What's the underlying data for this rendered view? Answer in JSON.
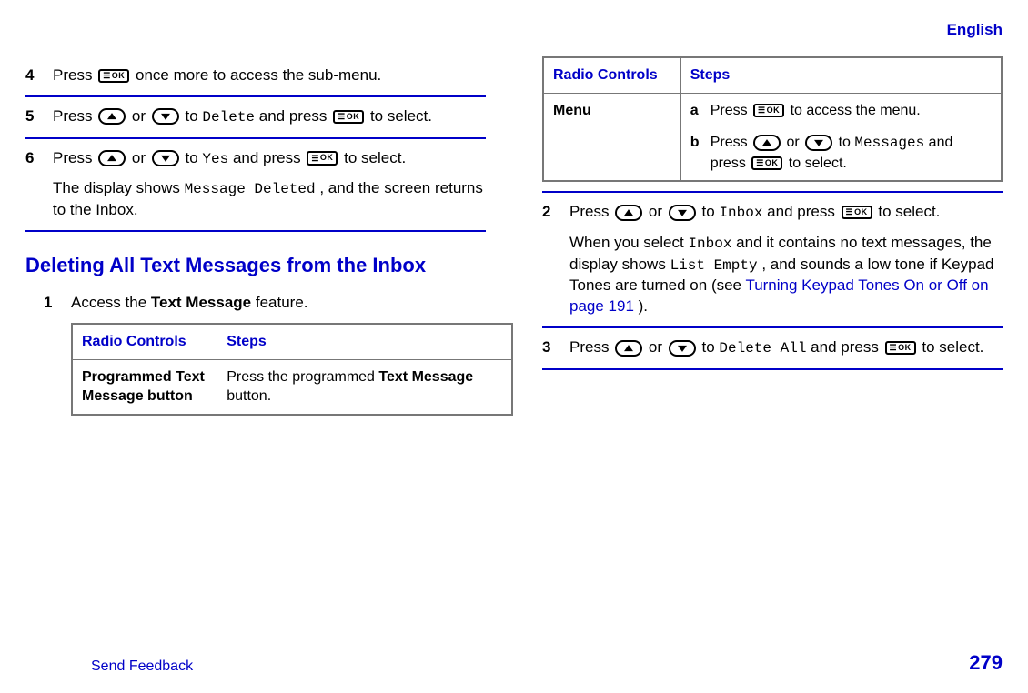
{
  "header": {
    "language": "English"
  },
  "left": {
    "steps": [
      {
        "num": "4",
        "parts": [
          {
            "pre": "Press ",
            "icon": "ok",
            "post": " once more to access the sub-menu."
          }
        ]
      },
      {
        "num": "5",
        "parts": [
          {
            "pre": "Press ",
            "icon": "up",
            "mid": " or ",
            "icon2": "down",
            "post_to": " to ",
            "mono": "Delete",
            "and_press": " and press ",
            "icon3": "ok",
            "tail": " to select."
          }
        ]
      },
      {
        "num": "6",
        "parts": [
          {
            "pre": "Press ",
            "icon": "up",
            "mid": " or ",
            "icon2": "down",
            "post_to": " to ",
            "mono": "Yes",
            "and_press": " and press ",
            "icon3": "ok",
            "tail": " to select."
          }
        ],
        "para2": {
          "t1": "The display shows ",
          "mono": "Message Deleted",
          "t2": ", and the screen returns to the Inbox."
        }
      }
    ],
    "section_title": "Deleting All Text Messages from the Inbox",
    "sub1": {
      "num": "1",
      "text_pre": "Access the ",
      "text_bold": "Text Message",
      "text_post": " feature."
    },
    "table1": {
      "h1": "Radio Controls",
      "h2": "Steps",
      "row1_c1": "Programmed Text Message button",
      "row1_c2_pre": "Press the programmed ",
      "row1_c2_bold": "Text Message",
      "row1_c2_post": " button."
    }
  },
  "right": {
    "table_menu": {
      "h1": "Radio Controls",
      "h2": "Steps",
      "row_c1": "Menu",
      "a": {
        "letter": "a",
        "pre": "Press ",
        "icon": "ok",
        "post": " to access the menu."
      },
      "b": {
        "letter": "b",
        "pre": "Press ",
        "icon": "up",
        "mid": " or ",
        "icon2": "down",
        "post_to": " to ",
        "mono": "Messages",
        "and_press": " and press ",
        "icon3": "ok",
        "tail": " to select."
      }
    },
    "step2": {
      "num": "2",
      "line1": {
        "pre": "Press ",
        "icon": "up",
        "mid": " or ",
        "icon2": "down",
        "post_to": " to ",
        "mono": "Inbox",
        "and_press": " and press ",
        "icon3": "ok",
        "tail": " to select."
      },
      "para2": {
        "t1": "When you select ",
        "mono1": "Inbox",
        "t2": " and it contains no text messages, the display shows ",
        "mono2": "List Empty",
        "t3": ", and sounds a low tone if Keypad Tones are turned on (see ",
        "link": "Turning Keypad Tones On or Off on page 191",
        "t4": ")."
      }
    },
    "step3": {
      "num": "3",
      "line1": {
        "pre": "Press ",
        "icon": "up",
        "mid": " or ",
        "icon2": "down",
        "post_to": " to ",
        "mono": "Delete All",
        "and_press": " and press ",
        "icon3": "ok",
        "tail": " to select."
      }
    }
  },
  "footer": {
    "feedback": "Send Feedback",
    "page": "279"
  }
}
